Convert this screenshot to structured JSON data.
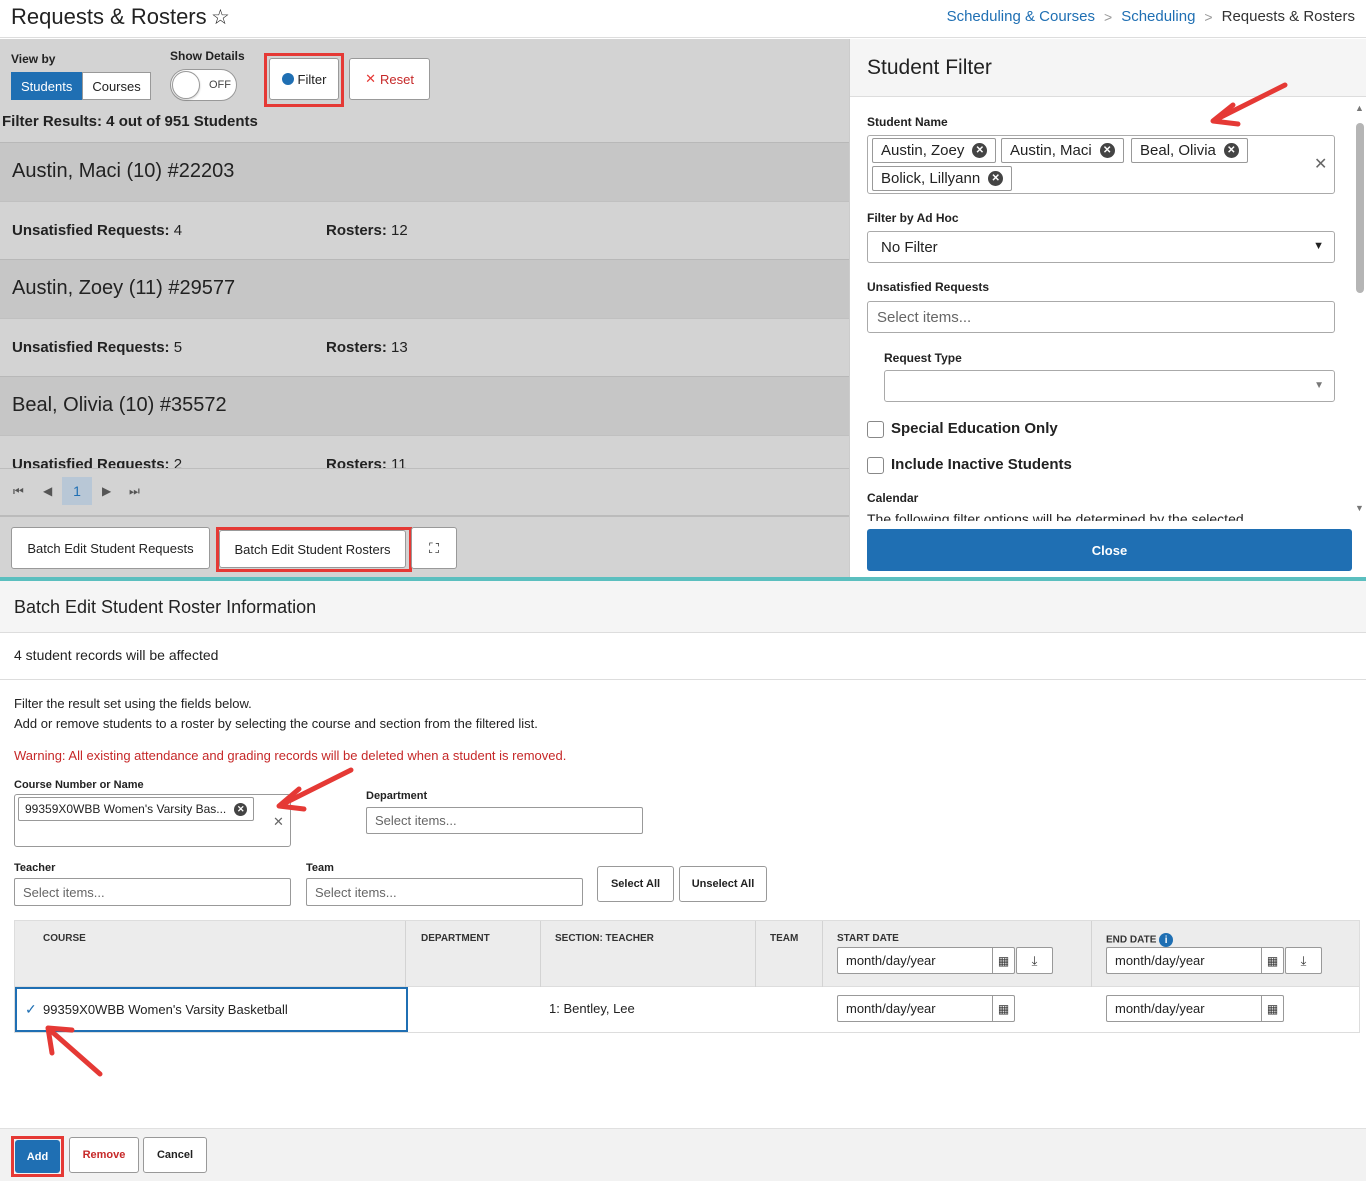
{
  "header": {
    "title": "Requests & Rosters",
    "breadcrumb": [
      "Scheduling & Courses",
      "Scheduling",
      "Requests & Rosters"
    ]
  },
  "left_panel": {
    "view_by_label": "View by",
    "view_by_options": [
      "Students",
      "Courses"
    ],
    "show_details_label": "Show Details",
    "show_details_state": "OFF",
    "filter_label": "Filter",
    "reset_label": "Reset",
    "filter_results": "Filter Results: 4 out of 951 Students",
    "students": [
      {
        "name": "Austin, Maci (10) #22203",
        "unsatisfied_label": "Unsatisfied Requests:",
        "unsatisfied": "4",
        "rosters_label": "Rosters:",
        "rosters": "12"
      },
      {
        "name": "Austin, Zoey (11) #29577",
        "unsatisfied_label": "Unsatisfied Requests:",
        "unsatisfied": "5",
        "rosters_label": "Rosters:",
        "rosters": "13"
      },
      {
        "name": "Beal, Olivia (10) #35572",
        "unsatisfied_label": "Unsatisfied Requests:",
        "unsatisfied": "2",
        "rosters_label": "Rosters:",
        "rosters": "11"
      }
    ],
    "pager_page": "1",
    "batch_requests_label": "Batch Edit Student Requests",
    "batch_rosters_label": "Batch Edit Student Rosters"
  },
  "student_filter": {
    "title": "Student Filter",
    "student_name_label": "Student Name",
    "selected_students": [
      "Austin, Zoey",
      "Austin, Maci",
      "Beal, Olivia",
      "Bolick, Lillyann"
    ],
    "ad_hoc_label": "Filter by Ad Hoc",
    "ad_hoc_value": "No Filter",
    "unsatisfied_label": "Unsatisfied Requests",
    "unsatisfied_placeholder": "Select items...",
    "request_type_label": "Request Type",
    "special_ed_label": "Special Education Only",
    "inactive_label": "Include Inactive Students",
    "calendar_label": "Calendar",
    "calendar_note": "The following filter options will be determined by the selected",
    "close_label": "Close"
  },
  "batch_edit": {
    "title": "Batch Edit Student Roster Information",
    "affected": "4 student records will be affected",
    "instruction_1": "Filter the result set using the fields below.",
    "instruction_2": "Add or remove students to a roster by selecting the course and section from the filtered list.",
    "warning": "Warning: All existing attendance and grading records will be deleted when a student is removed.",
    "course_label": "Course Number or Name",
    "course_chip": "99359X0WBB Women's Varsity Bas...",
    "department_label": "Department",
    "department_placeholder": "Select items...",
    "teacher_label": "Teacher",
    "teacher_placeholder": "Select items...",
    "team_label": "Team",
    "team_placeholder": "Select items...",
    "select_all_label": "Select All",
    "unselect_all_label": "Unselect All",
    "table": {
      "headers": [
        "COURSE",
        "DEPARTMENT",
        "SECTION: TEACHER",
        "TEAM",
        "START DATE",
        "END DATE"
      ],
      "date_placeholder": "month/day/year",
      "rows": [
        {
          "course": "99359X0WBB Women's Varsity Basketball",
          "department": "",
          "section_teacher": "1: Bentley, Lee",
          "team": "",
          "start_date": "month/day/year",
          "end_date": "month/day/year"
        }
      ]
    },
    "add_label": "Add",
    "remove_label": "Remove",
    "cancel_label": "Cancel"
  },
  "colors": {
    "primary": "#1f6fb3",
    "highlight_box": "#e53935",
    "warning": "#c62828",
    "divider": "#5bbfbf"
  }
}
